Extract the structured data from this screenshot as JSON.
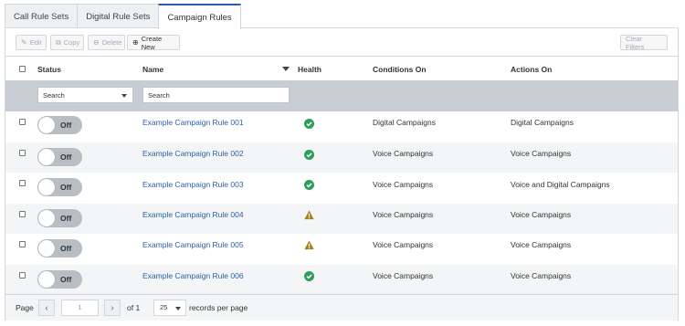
{
  "tabs": [
    {
      "label": "Call Rule Sets"
    },
    {
      "label": "Digital Rule Sets"
    },
    {
      "label": "Campaign Rules"
    }
  ],
  "toolbar": {
    "edit_label": "Edit",
    "copy_label": "Copy",
    "delete_label": "Delete",
    "create_label": "Create New",
    "clear_filters_label": "Clear Filters"
  },
  "columns": {
    "status": "Status",
    "name": "Name",
    "health": "Health",
    "conditions": "Conditions On",
    "actions": "Actions On"
  },
  "filters": {
    "status_select_value": "Search",
    "name_placeholder": "Search"
  },
  "rows": [
    {
      "toggle": "Off",
      "name": "Example Campaign Rule 001",
      "health": "ok-check-icon",
      "conditions": "Digital Campaigns",
      "actions": "Digital Campaigns"
    },
    {
      "toggle": "Off",
      "name": "Example Campaign Rule 002",
      "health": "ok-check-icon",
      "conditions": "Voice Campaigns",
      "actions": "Voice Campaigns"
    },
    {
      "toggle": "Off",
      "name": "Example Campaign Rule 003",
      "health": "ok-check-icon",
      "conditions": "Voice Campaigns",
      "actions": "Voice and Digital Campaigns"
    },
    {
      "toggle": "Off",
      "name": "Example Campaign Rule 004",
      "health": "warning-icon",
      "conditions": "Voice Campaigns",
      "actions": "Voice Campaigns"
    },
    {
      "toggle": "Off",
      "name": "Example Campaign Rule 005",
      "health": "warning-icon",
      "conditions": "Voice Campaigns",
      "actions": "Voice Campaigns"
    },
    {
      "toggle": "Off",
      "name": "Example Campaign Rule 006",
      "health": "ok-check-icon",
      "conditions": "Voice Campaigns",
      "actions": "Voice Campaigns"
    }
  ],
  "pagination": {
    "page_label": "Page",
    "current_page": "1",
    "of_label": "of 1",
    "page_size": "25",
    "per_page_label": "records per page"
  },
  "colors": {
    "accent": "#2a5fa8",
    "ok": "#2e9e5b",
    "warning": "#a0801b",
    "filter_bar": "#c8ccd3"
  }
}
